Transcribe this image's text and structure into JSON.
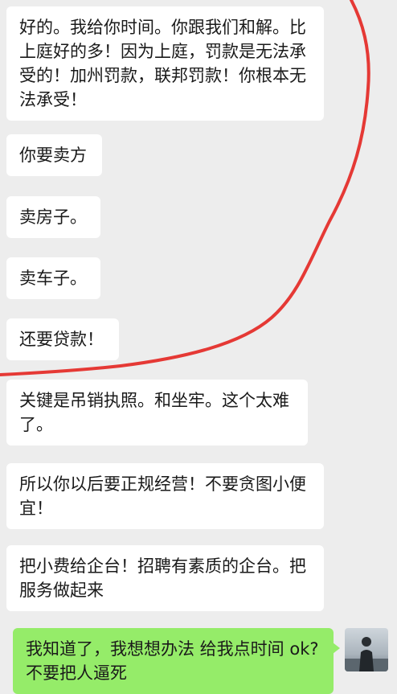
{
  "conversation": {
    "incoming": [
      {
        "text": "好的。我给你时间。你跟我们和解。比上庭好的多！因为上庭，罚款是无法承受的！加州罚款，联邦罚款！你根本无法承受！"
      },
      {
        "text": "你要卖方"
      },
      {
        "text": "卖房子。"
      },
      {
        "text": "卖车子。"
      },
      {
        "text": "还要贷款！"
      },
      {
        "text": "关键是吊销执照。和坐牢。这个太难了。"
      },
      {
        "text": "所以你以后要正规经营！不要贪图小便宜！"
      },
      {
        "text": "把小费给企台！招聘有素质的企台。把服务做起来"
      }
    ],
    "outgoing": [
      {
        "text": "我知道了，我想想办法 给我点时间 ok? 不要把人逼死"
      }
    ]
  },
  "colors": {
    "background": "#ededed",
    "incoming_bubble": "#ffffff",
    "outgoing_bubble": "#95ec69",
    "annotation_stroke": "#e53935"
  },
  "icons": {
    "avatar": "user-avatar-photo"
  }
}
